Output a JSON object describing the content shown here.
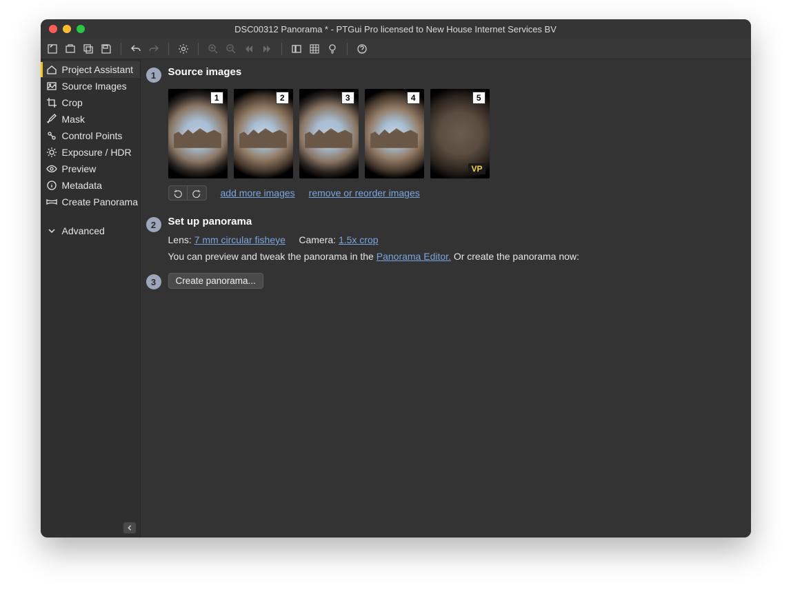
{
  "title": "DSC00312 Panorama * - PTGui Pro licensed to New House Internet Services BV",
  "sidebar": {
    "items": [
      {
        "label": "Project Assistant"
      },
      {
        "label": "Source Images"
      },
      {
        "label": "Crop"
      },
      {
        "label": "Mask"
      },
      {
        "label": "Control Points"
      },
      {
        "label": "Exposure / HDR"
      },
      {
        "label": "Preview"
      },
      {
        "label": "Metadata"
      },
      {
        "label": "Create Panorama"
      }
    ],
    "advanced": "Advanced"
  },
  "step1": {
    "num": "1",
    "title": "Source images",
    "thumbs": [
      "1",
      "2",
      "3",
      "4",
      "5"
    ],
    "vp": "VP",
    "add": "add more images",
    "remove": "remove or reorder images"
  },
  "step2": {
    "num": "2",
    "title": "Set up panorama",
    "lens_label": "Lens:",
    "lens_value": "7 mm circular fisheye",
    "camera_label": "Camera:",
    "camera_value": "1.5x crop",
    "preview_pre": "You can preview and tweak the panorama in the",
    "editor_link": "Panorama Editor.",
    "preview_post": "Or create the panorama now:"
  },
  "step3": {
    "num": "3",
    "button": "Create panorama..."
  }
}
